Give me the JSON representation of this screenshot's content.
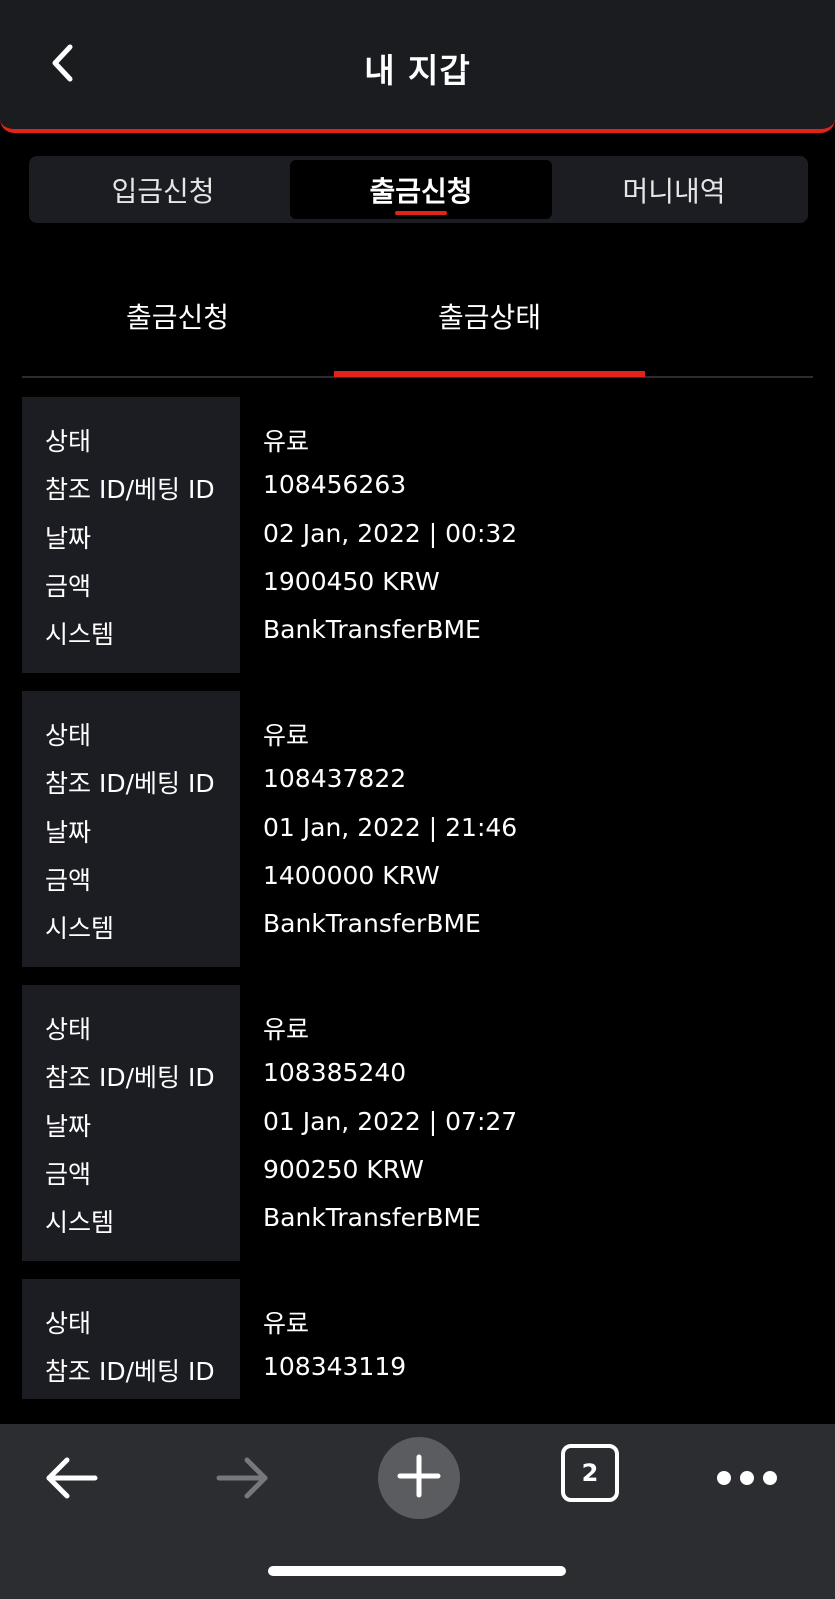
{
  "header": {
    "title": "내 지갑",
    "back_icon": "chevron-left-icon"
  },
  "main_tabs": [
    {
      "label": "입금신청",
      "active": false
    },
    {
      "label": "출금신청",
      "active": true
    },
    {
      "label": "머니내역",
      "active": false
    }
  ],
  "sub_tabs": [
    {
      "label": "출금신청",
      "active": false
    },
    {
      "label": "출금상태",
      "active": true
    }
  ],
  "field_labels": {
    "status": "상태",
    "ref_id": "참조 ID/베팅 ID",
    "date": "날짜",
    "amount": "금액",
    "system": "시스템"
  },
  "records": [
    {
      "status": "유료",
      "ref_id": "108456263",
      "date": "02 Jan, 2022 | 00:32",
      "amount": "1900450 KRW",
      "system": "BankTransferBME"
    },
    {
      "status": "유료",
      "ref_id": "108437822",
      "date": "01 Jan, 2022 | 21:46",
      "amount": "1400000 KRW",
      "system": "BankTransferBME"
    },
    {
      "status": "유료",
      "ref_id": "108385240",
      "date": "01 Jan, 2022 | 07:27",
      "amount": "900250 KRW",
      "system": "BankTransferBME"
    },
    {
      "status": "유료",
      "ref_id": "108343119"
    }
  ],
  "browser_bar": {
    "back_icon": "arrow-left-icon",
    "forward_icon": "arrow-right-icon",
    "forward_enabled": false,
    "add_icon": "plus-icon",
    "tab_count": "2",
    "more_icon": "more-horizontal-icon"
  },
  "colors": {
    "accent": "#e2231a",
    "background": "#000000",
    "panel": "#1c1d22",
    "header": "#1b1c20",
    "browser_bar": "#2c2d31"
  }
}
